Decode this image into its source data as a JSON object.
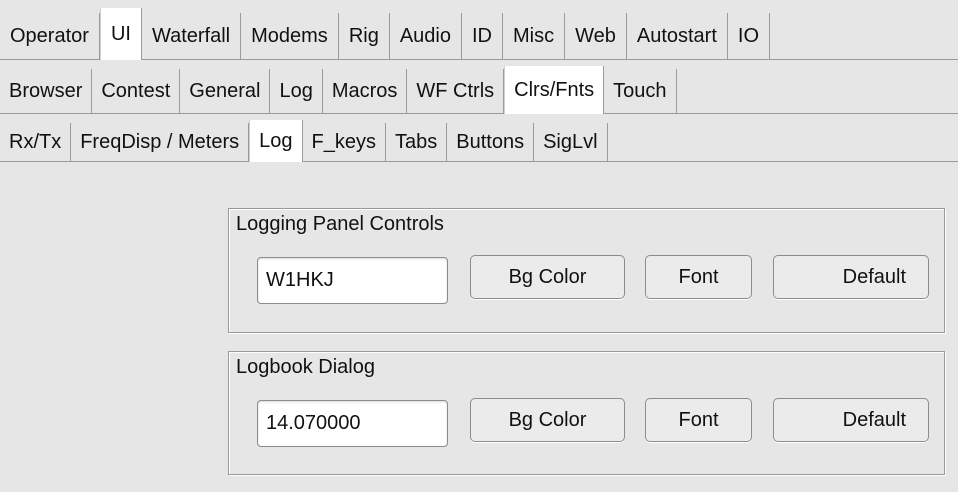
{
  "tabs_top": [
    "Operator",
    "UI",
    "Waterfall",
    "Modems",
    "Rig",
    "Audio",
    "ID",
    "Misc",
    "Web",
    "Autostart",
    "IO"
  ],
  "tabs_ui": [
    "Browser",
    "Contest",
    "General",
    "Log",
    "Macros",
    "WF Ctrls",
    "Clrs/Fnts",
    "Touch"
  ],
  "tabs_clrs": [
    "Rx/Tx",
    "FreqDisp / Meters",
    "Log",
    "F_keys",
    "Tabs",
    "Buttons",
    "SigLvl"
  ],
  "logging_panel": {
    "label": "Logging Panel Controls",
    "value": "W1HKJ",
    "bg_label": "Bg Color",
    "font_label": "Font",
    "default_label": "Default"
  },
  "logbook_dialog": {
    "label": "Logbook Dialog",
    "value": "14.070000",
    "bg_label": "Bg Color",
    "font_label": "Font",
    "default_label": "Default"
  }
}
